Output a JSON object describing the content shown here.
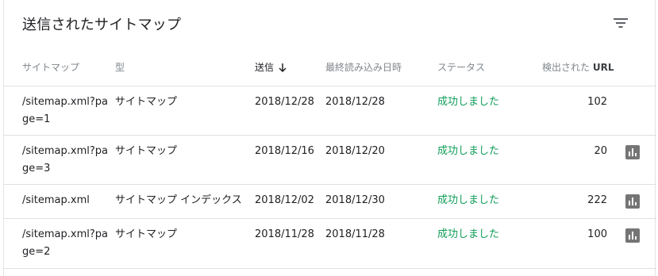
{
  "card": {
    "title": "送信されたサイトマップ",
    "filter_icon": "filter-icon"
  },
  "columns": {
    "sitemap": "サイトマップ",
    "type": "型",
    "submitted": "送信",
    "last_read": "最終読み込み日時",
    "status": "ステータス",
    "discovered_prefix": "検出された",
    "discovered_suffix": "URL"
  },
  "rows": [
    {
      "sitemap": "/sitemap.xml?page=1",
      "type": "サイトマップ",
      "submitted": "2018/12/28",
      "last_read": "2018/12/28",
      "status": "成功しました",
      "discovered": "102",
      "chart_icon": false
    },
    {
      "sitemap": "/sitemap.xml?page=3",
      "type": "サイトマップ",
      "submitted": "2018/12/16",
      "last_read": "2018/12/20",
      "status": "成功しました",
      "discovered": "20",
      "chart_icon": true
    },
    {
      "sitemap": "/sitemap.xml",
      "type": "サイトマップ インデックス",
      "submitted": "2018/12/02",
      "last_read": "2018/12/30",
      "status": "成功しました",
      "discovered": "222",
      "chart_icon": true
    },
    {
      "sitemap": "/sitemap.xml?page=2",
      "type": "サイトマップ",
      "submitted": "2018/11/28",
      "last_read": "2018/11/28",
      "status": "成功しました",
      "discovered": "100",
      "chart_icon": true
    }
  ],
  "colors": {
    "status_success": "#0f9d58",
    "header_text": "#80868b",
    "icon_gray": "#757575"
  }
}
